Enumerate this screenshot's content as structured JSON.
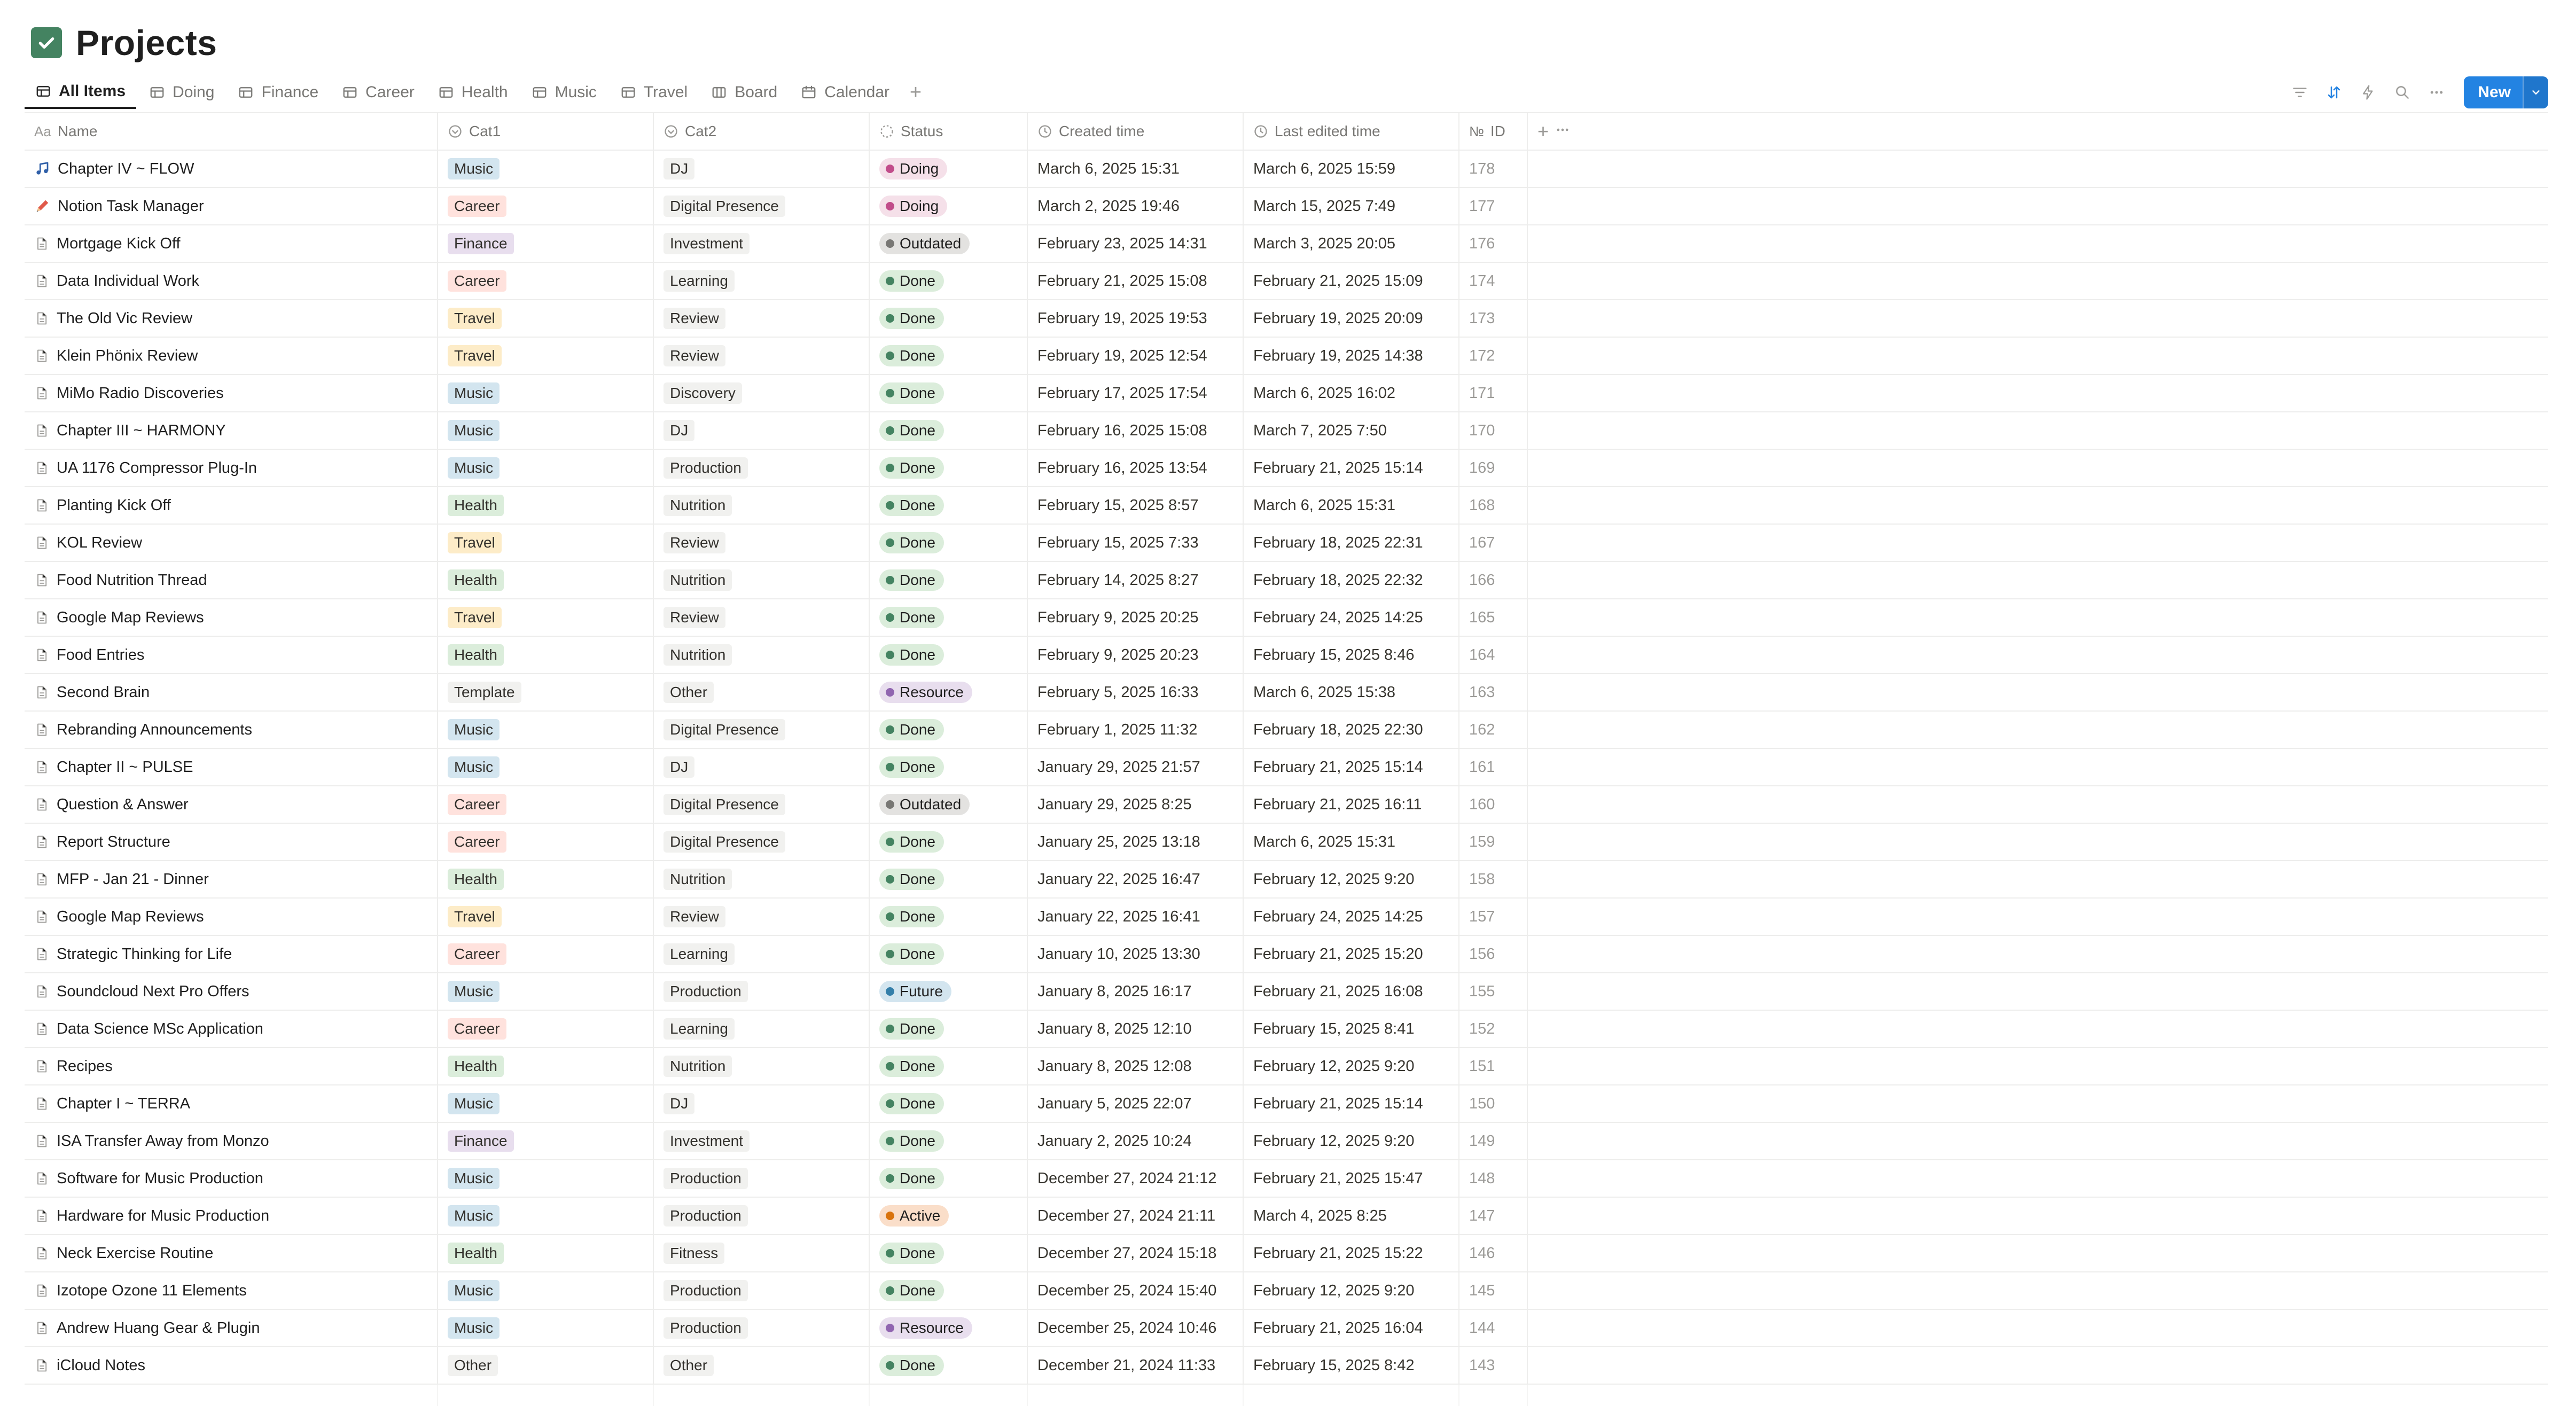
{
  "page": {
    "title": "Projects"
  },
  "views": [
    {
      "label": "All Items",
      "icon": "table-icon",
      "active": true
    },
    {
      "label": "Doing",
      "icon": "table-icon"
    },
    {
      "label": "Finance",
      "icon": "table-icon"
    },
    {
      "label": "Career",
      "icon": "table-icon"
    },
    {
      "label": "Health",
      "icon": "table-icon"
    },
    {
      "label": "Music",
      "icon": "table-icon"
    },
    {
      "label": "Travel",
      "icon": "table-icon"
    },
    {
      "label": "Board",
      "icon": "board-icon"
    },
    {
      "label": "Calendar",
      "icon": "calendar-icon"
    }
  ],
  "toolbar": {
    "new_label": "New"
  },
  "columns": {
    "name": "Name",
    "cat1": "Cat1",
    "cat2": "Cat2",
    "status": "Status",
    "created": "Created time",
    "edited": "Last edited time",
    "id": "ID",
    "name_prefix": "Aa",
    "id_prefix": "№"
  },
  "colors": {
    "accent": "#2383e2",
    "title_check": "#448361"
  },
  "rows": [
    {
      "icon": "music-note-icon",
      "name": "Chapter IV ~ FLOW",
      "cat1": "Music",
      "cat2": "DJ",
      "status": "Doing",
      "created": "March 6, 2025 15:31",
      "edited": "March 6, 2025 15:59",
      "id": "178"
    },
    {
      "icon": "pencil-icon",
      "name": "Notion Task Manager",
      "cat1": "Career",
      "cat2": "Digital Presence",
      "status": "Doing",
      "created": "March 2, 2025 19:46",
      "edited": "March 15, 2025 7:49",
      "id": "177"
    },
    {
      "icon": "page-icon",
      "name": "Mortgage Kick Off",
      "cat1": "Finance",
      "cat2": "Investment",
      "status": "Outdated",
      "created": "February 23, 2025 14:31",
      "edited": "March 3, 2025 20:05",
      "id": "176"
    },
    {
      "icon": "page-icon",
      "name": "Data Individual Work",
      "cat1": "Career",
      "cat2": "Learning",
      "status": "Done",
      "created": "February 21, 2025 15:08",
      "edited": "February 21, 2025 15:09",
      "id": "174"
    },
    {
      "icon": "page-icon",
      "name": "The Old Vic Review",
      "cat1": "Travel",
      "cat2": "Review",
      "status": "Done",
      "created": "February 19, 2025 19:53",
      "edited": "February 19, 2025 20:09",
      "id": "173"
    },
    {
      "icon": "page-icon",
      "name": "Klein Phönix Review",
      "cat1": "Travel",
      "cat2": "Review",
      "status": "Done",
      "created": "February 19, 2025 12:54",
      "edited": "February 19, 2025 14:38",
      "id": "172"
    },
    {
      "icon": "page-icon",
      "name": "MiMo Radio Discoveries",
      "cat1": "Music",
      "cat2": "Discovery",
      "status": "Done",
      "created": "February 17, 2025 17:54",
      "edited": "March 6, 2025 16:02",
      "id": "171"
    },
    {
      "icon": "page-icon",
      "name": "Chapter III ~ HARMONY",
      "cat1": "Music",
      "cat2": "DJ",
      "status": "Done",
      "created": "February 16, 2025 15:08",
      "edited": "March 7, 2025 7:50",
      "id": "170"
    },
    {
      "icon": "page-icon",
      "name": "UA 1176 Compressor Plug-In",
      "cat1": "Music",
      "cat2": "Production",
      "status": "Done",
      "created": "February 16, 2025 13:54",
      "edited": "February 21, 2025 15:14",
      "id": "169"
    },
    {
      "icon": "page-icon",
      "name": "Planting Kick Off",
      "cat1": "Health",
      "cat2": "Nutrition",
      "status": "Done",
      "created": "February 15, 2025 8:57",
      "edited": "March 6, 2025 15:31",
      "id": "168"
    },
    {
      "icon": "page-icon",
      "name": "KOL Review",
      "cat1": "Travel",
      "cat2": "Review",
      "status": "Done",
      "created": "February 15, 2025 7:33",
      "edited": "February 18, 2025 22:31",
      "id": "167"
    },
    {
      "icon": "page-icon",
      "name": "Food Nutrition Thread",
      "cat1": "Health",
      "cat2": "Nutrition",
      "status": "Done",
      "created": "February 14, 2025 8:27",
      "edited": "February 18, 2025 22:32",
      "id": "166"
    },
    {
      "icon": "page-icon",
      "name": "Google Map Reviews",
      "cat1": "Travel",
      "cat2": "Review",
      "status": "Done",
      "created": "February 9, 2025 20:25",
      "edited": "February 24, 2025 14:25",
      "id": "165"
    },
    {
      "icon": "page-icon",
      "name": "Food Entries",
      "cat1": "Health",
      "cat2": "Nutrition",
      "status": "Done",
      "created": "February 9, 2025 20:23",
      "edited": "February 15, 2025 8:46",
      "id": "164"
    },
    {
      "icon": "page-icon",
      "name": "Second Brain",
      "cat1": "Template",
      "cat2": "Other",
      "status": "Resource",
      "created": "February 5, 2025 16:33",
      "edited": "March 6, 2025 15:38",
      "id": "163"
    },
    {
      "icon": "page-icon",
      "name": "Rebranding Announcements",
      "cat1": "Music",
      "cat2": "Digital Presence",
      "status": "Done",
      "created": "February 1, 2025 11:32",
      "edited": "February 18, 2025 22:30",
      "id": "162"
    },
    {
      "icon": "page-icon",
      "name": "Chapter II ~ PULSE",
      "cat1": "Music",
      "cat2": "DJ",
      "status": "Done",
      "created": "January 29, 2025 21:57",
      "edited": "February 21, 2025 15:14",
      "id": "161"
    },
    {
      "icon": "page-icon",
      "name": "Question & Answer",
      "cat1": "Career",
      "cat2": "Digital Presence",
      "status": "Outdated",
      "created": "January 29, 2025 8:25",
      "edited": "February 21, 2025 16:11",
      "id": "160"
    },
    {
      "icon": "page-icon",
      "name": "Report Structure",
      "cat1": "Career",
      "cat2": "Digital Presence",
      "status": "Done",
      "created": "January 25, 2025 13:18",
      "edited": "March 6, 2025 15:31",
      "id": "159"
    },
    {
      "icon": "page-icon",
      "name": "MFP - Jan 21 - Dinner",
      "cat1": "Health",
      "cat2": "Nutrition",
      "status": "Done",
      "created": "January 22, 2025 16:47",
      "edited": "February 12, 2025 9:20",
      "id": "158"
    },
    {
      "icon": "page-icon",
      "name": "Google Map Reviews",
      "cat1": "Travel",
      "cat2": "Review",
      "status": "Done",
      "created": "January 22, 2025 16:41",
      "edited": "February 24, 2025 14:25",
      "id": "157"
    },
    {
      "icon": "page-icon",
      "name": "Strategic Thinking for Life",
      "cat1": "Career",
      "cat2": "Learning",
      "status": "Done",
      "created": "January 10, 2025 13:30",
      "edited": "February 21, 2025 15:20",
      "id": "156"
    },
    {
      "icon": "page-icon",
      "name": "Soundcloud Next Pro Offers",
      "cat1": "Music",
      "cat2": "Production",
      "status": "Future",
      "created": "January 8, 2025 16:17",
      "edited": "February 21, 2025 16:08",
      "id": "155"
    },
    {
      "icon": "page-icon",
      "name": "Data Science MSc Application",
      "cat1": "Career",
      "cat2": "Learning",
      "status": "Done",
      "created": "January 8, 2025 12:10",
      "edited": "February 15, 2025 8:41",
      "id": "152"
    },
    {
      "icon": "page-icon",
      "name": "Recipes",
      "cat1": "Health",
      "cat2": "Nutrition",
      "status": "Done",
      "created": "January 8, 2025 12:08",
      "edited": "February 12, 2025 9:20",
      "id": "151"
    },
    {
      "icon": "page-icon",
      "name": "Chapter I ~ TERRA",
      "cat1": "Music",
      "cat2": "DJ",
      "status": "Done",
      "created": "January 5, 2025 22:07",
      "edited": "February 21, 2025 15:14",
      "id": "150"
    },
    {
      "icon": "page-icon",
      "name": "ISA Transfer Away from Monzo",
      "cat1": "Finance",
      "cat2": "Investment",
      "status": "Done",
      "created": "January 2, 2025 10:24",
      "edited": "February 12, 2025 9:20",
      "id": "149"
    },
    {
      "icon": "page-icon",
      "name": "Software for Music Production",
      "cat1": "Music",
      "cat2": "Production",
      "status": "Done",
      "created": "December 27, 2024 21:12",
      "edited": "February 21, 2025 15:47",
      "id": "148"
    },
    {
      "icon": "page-icon",
      "name": "Hardware for Music Production",
      "cat1": "Music",
      "cat2": "Production",
      "status": "Active",
      "created": "December 27, 2024 21:11",
      "edited": "March 4, 2025 8:25",
      "id": "147"
    },
    {
      "icon": "page-icon",
      "name": "Neck Exercise Routine",
      "cat1": "Health",
      "cat2": "Fitness",
      "status": "Done",
      "created": "December 27, 2024 15:18",
      "edited": "February 21, 2025 15:22",
      "id": "146"
    },
    {
      "icon": "page-icon",
      "name": "Izotope Ozone 11 Elements",
      "cat1": "Music",
      "cat2": "Production",
      "status": "Done",
      "created": "December 25, 2024 15:40",
      "edited": "February 12, 2025 9:20",
      "id": "145"
    },
    {
      "icon": "page-icon",
      "name": "Andrew Huang Gear & Plugin",
      "cat1": "Music",
      "cat2": "Production",
      "status": "Resource",
      "created": "December 25, 2024 10:46",
      "edited": "February 21, 2025 16:04",
      "id": "144"
    },
    {
      "icon": "page-icon",
      "name": "iCloud Notes",
      "cat1": "Other",
      "cat2": "Other",
      "status": "Done",
      "created": "December 21, 2024 11:33",
      "edited": "February 15, 2025 8:42",
      "id": "143"
    }
  ]
}
